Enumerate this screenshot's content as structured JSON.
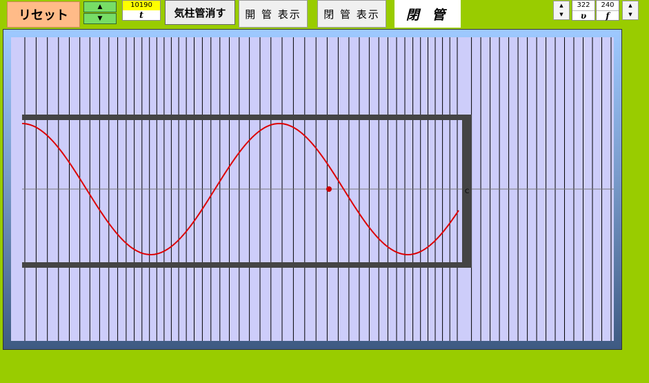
{
  "toolbar": {
    "reset_label": "リセット",
    "up_arrow": "▲",
    "down_arrow": "▼",
    "t_value": "10190",
    "t_label": "t",
    "hide_air_column_label": "気柱管消す",
    "show_open_tube_1_label": "開 管 表示",
    "show_open_tube_2_label": "閉 管 表示",
    "mode_label": "閉 管",
    "v_value": "322",
    "v_label": "υ",
    "f_value": "240",
    "f_label": "f"
  },
  "simulation": {
    "tube_end_label": "C",
    "colors": {
      "wave": "#dd0000",
      "background": "#cdcdfa",
      "tube": "#444444",
      "lines": "#000000"
    }
  }
}
